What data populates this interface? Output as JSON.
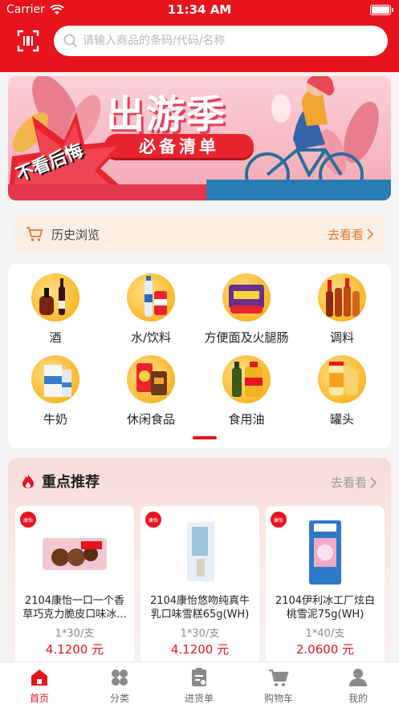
{
  "status": {
    "carrier": "Carrier",
    "time": "11:34 AM"
  },
  "search": {
    "placeholder": "请输入商品的条码/代码/名称"
  },
  "banner": {
    "title": "出游季",
    "subtitle": "必备清单",
    "burst": "不看后悔"
  },
  "history": {
    "label": "历史浏览",
    "more": "去看看"
  },
  "categories": [
    {
      "label": "酒",
      "icon": "wine-icon"
    },
    {
      "label": "水/饮料",
      "icon": "beverage-icon"
    },
    {
      "label": "方便面及火腿肠",
      "icon": "instant-noodle-icon"
    },
    {
      "label": "调料",
      "icon": "seasoning-icon"
    },
    {
      "label": "牛奶",
      "icon": "milk-icon"
    },
    {
      "label": "休闲食品",
      "icon": "snack-icon"
    },
    {
      "label": "食用油",
      "icon": "cooking-oil-icon"
    },
    {
      "label": "罐头",
      "icon": "canned-food-icon"
    }
  ],
  "recommend": {
    "title": "重点推荐",
    "more": "去看看",
    "products": [
      {
        "name": "2104康怡一口一个香草巧克力脆皮口味冰...",
        "spec": "1*30/支",
        "price": "4.1200 元"
      },
      {
        "name": "2104康怡悠吻纯真牛乳口味雪糕65g(WH)",
        "spec": "1*30/支",
        "price": "4.1200 元"
      },
      {
        "name": "2104伊利冰工厂炫白桃雪泥75g(WH)",
        "spec": "1*40/支",
        "price": "2.0600 元"
      }
    ]
  },
  "tabs": [
    {
      "label": "首页",
      "icon": "home-icon",
      "active": true
    },
    {
      "label": "分类",
      "icon": "category-icon"
    },
    {
      "label": "进货单",
      "icon": "order-icon"
    },
    {
      "label": "购物车",
      "icon": "cart-icon"
    },
    {
      "label": "我的",
      "icon": "profile-icon"
    }
  ],
  "colors": {
    "primary": "#e8141d",
    "accent": "#e07a2a",
    "background": "#f4f4f4"
  }
}
